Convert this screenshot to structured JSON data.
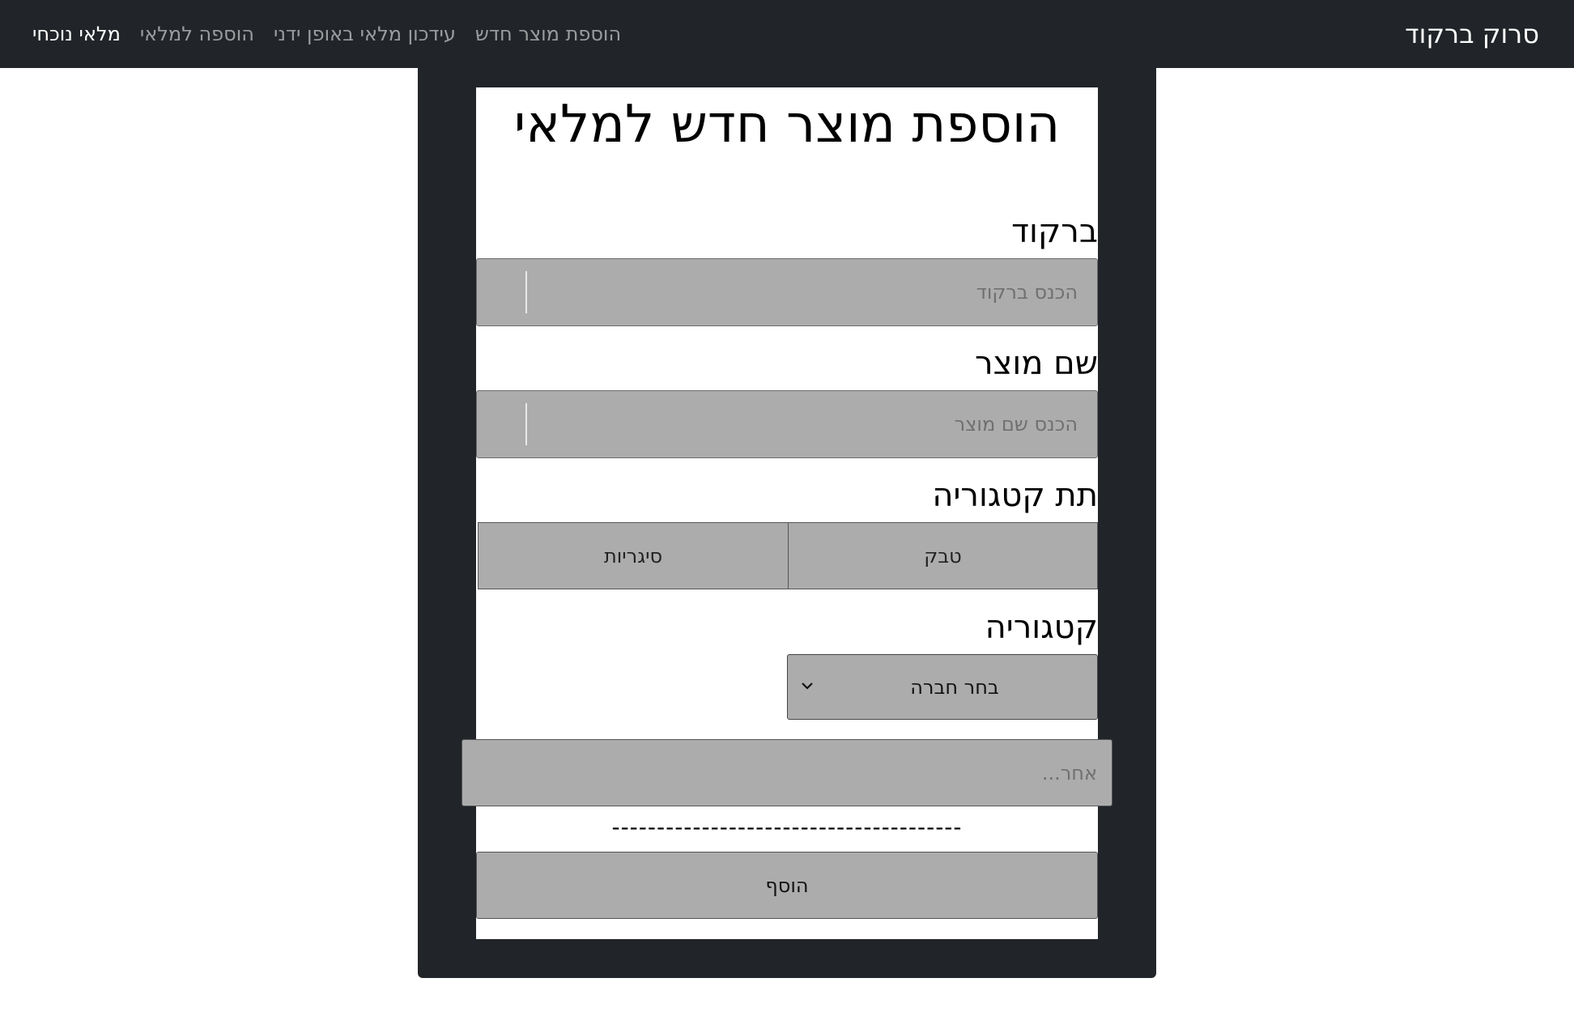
{
  "navbar": {
    "brand": "סרוק ברקוד",
    "links": [
      {
        "label": "מלאי נוכחי",
        "active": true
      },
      {
        "label": "הוספה למלאי",
        "active": false
      },
      {
        "label": "עידכון מלאי באופן ידני",
        "active": false
      },
      {
        "label": "הוספת מוצר חדש",
        "active": false
      }
    ]
  },
  "form": {
    "title": "הוספת מוצר חדש למלאי",
    "barcode": {
      "label": "ברקוד",
      "placeholder": "הכנס ברקוד",
      "value": ""
    },
    "product_name": {
      "label": "שם מוצר",
      "placeholder": "הכנס שם מוצר",
      "value": ""
    },
    "subcategory": {
      "label": "תת קטגוריה",
      "options": [
        "טבק",
        "סיגריות"
      ]
    },
    "category": {
      "label": "קטגוריה",
      "selected": "בחר חברה"
    },
    "other": {
      "placeholder": "אחר...",
      "value": ""
    },
    "divider": "---------------------------------------",
    "submit_label": "הוסף"
  },
  "colors": {
    "navbar_bg": "#212529",
    "card_bg": "#212529",
    "field_bg": "#acacac"
  }
}
